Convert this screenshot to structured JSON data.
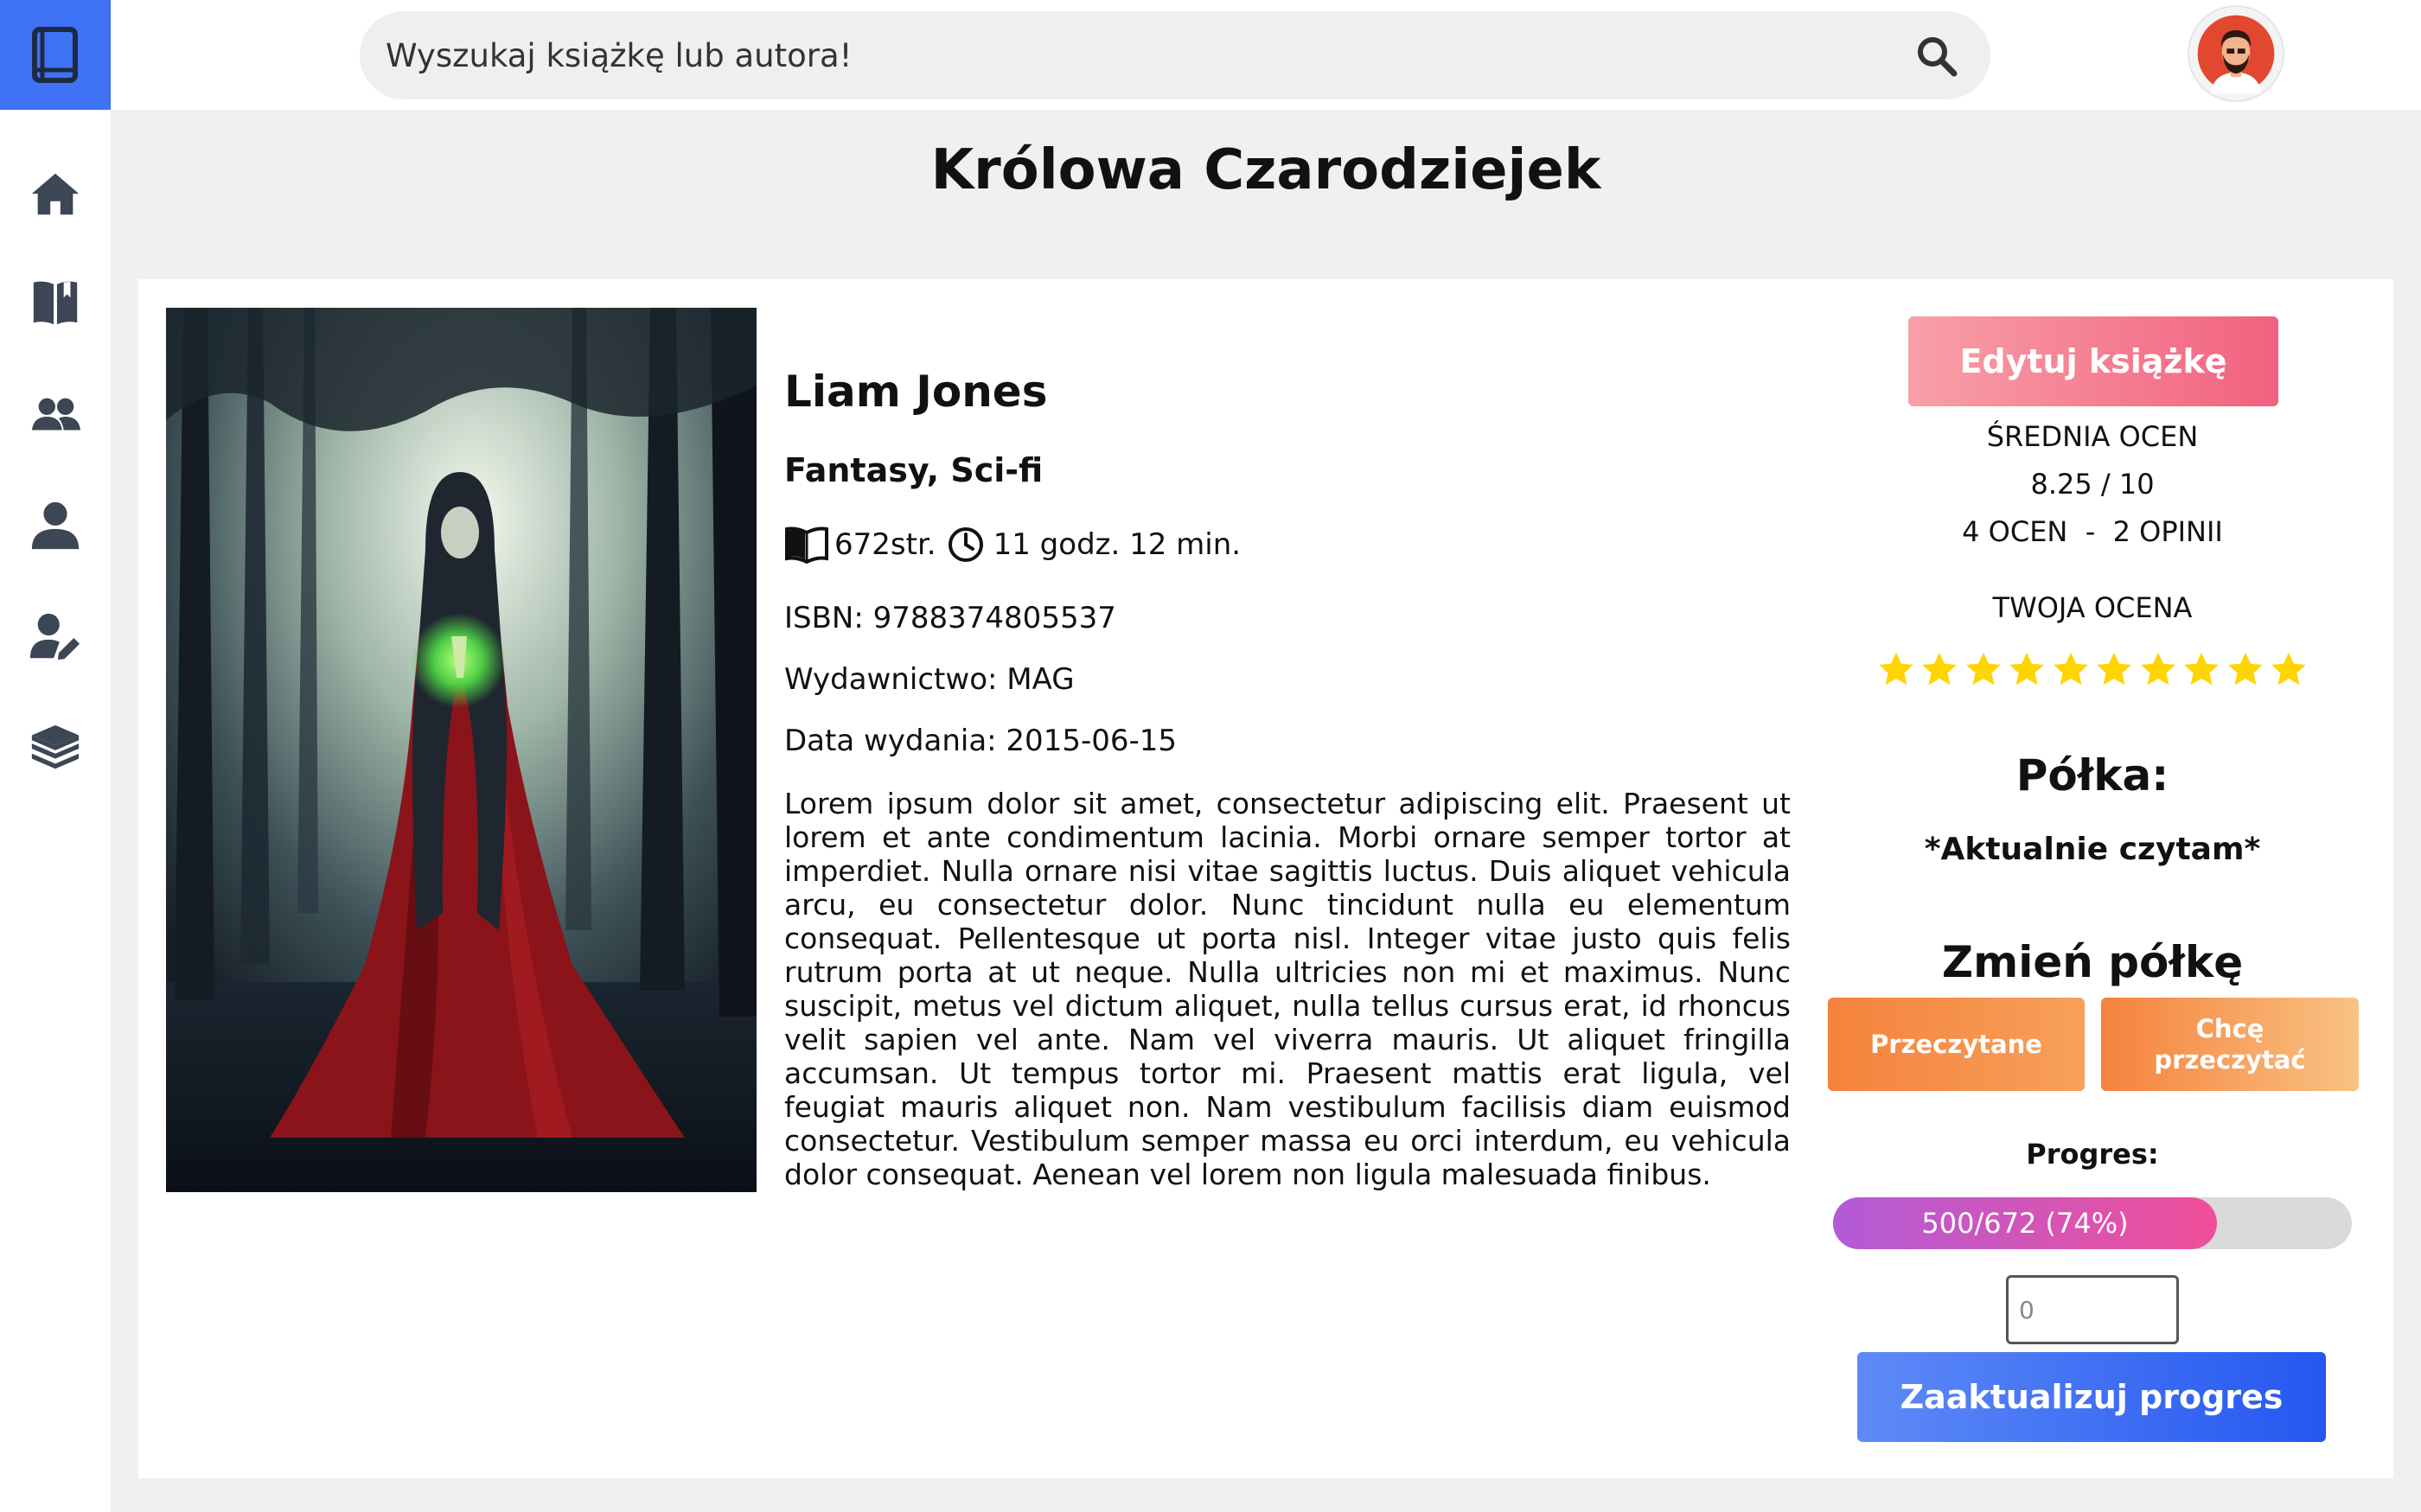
{
  "header": {
    "search_placeholder": "Wyszukaj książkę lub autora!",
    "search_icon": "search-icon",
    "avatar_icon": "user-avatar"
  },
  "sidebar": {
    "logo_icon": "book-icon",
    "items": [
      {
        "icon": "home-icon"
      },
      {
        "icon": "book-open-icon"
      },
      {
        "icon": "users-icon"
      },
      {
        "icon": "user-icon"
      },
      {
        "icon": "user-edit-icon"
      },
      {
        "icon": "books-stack-icon"
      }
    ]
  },
  "book": {
    "title": "Królowa Czarodziejek",
    "author": "Liam Jones",
    "genres": "Fantasy, Sci-fi",
    "pages": "672str.",
    "reading_time": "11 godz. 12 min.",
    "isbn": "ISBN: 9788374805537",
    "publisher": "Wydawnictwo: MAG",
    "release_date": "Data wydania: 2015-06-15",
    "description": "Lorem ipsum dolor sit amet, consectetur adipiscing elit. Praesent ut lorem et ante condimentum lacinia. Morbi ornare semper tortor at imperdiet. Nulla ornare nisi vitae sagittis luctus. Duis aliquet vehicula arcu, eu consectetur dolor. Nunc tincidunt nulla eu elementum consequat. Pellentesque ut porta nisl. Integer vitae justo quis felis rutrum porta at ut neque. Nulla ultricies non mi et maximus. Nunc suscipit, metus vel dictum aliquet, nulla tellus cursus erat, id rhoncus velit sapien vel ante. Nam vel viverra mauris. Ut aliquet fringilla accumsan. Ut tempus tortor mi. Praesent mattis erat ligula, vel feugiat mauris aliquet non. Nam vestibulum facilisis diam euismod consectetur. Vestibulum semper massa eu orci interdum, eu vehicula dolor consequat. Aenean vel lorem non ligula malesuada finibus."
  },
  "ratings": {
    "edit_button": "Edytuj książkę",
    "average_label": "ŚREDNIA OCEN",
    "average_value": "8.25 / 10",
    "counts": "4 OCEN  -  2 OPINII",
    "your_rating_label": "TWOJA OCENA",
    "your_rating_stars": 10,
    "max_stars": 10,
    "star_color": "#ffd400"
  },
  "shelf": {
    "heading": "Półka:",
    "current": "*Aktualnie czytam*",
    "change_heading": "Zmień półkę",
    "buttons": [
      "Przeczytane",
      "Chcę przeczytać"
    ]
  },
  "progress": {
    "label": "Progres:",
    "text": "500/672 (74%)",
    "fraction": 0.74,
    "input_placeholder": "0",
    "update_button": "Zaaktualizuj progres"
  },
  "colors": {
    "accent_blue": "#3f72f4",
    "icon_gray": "#3d4654"
  }
}
